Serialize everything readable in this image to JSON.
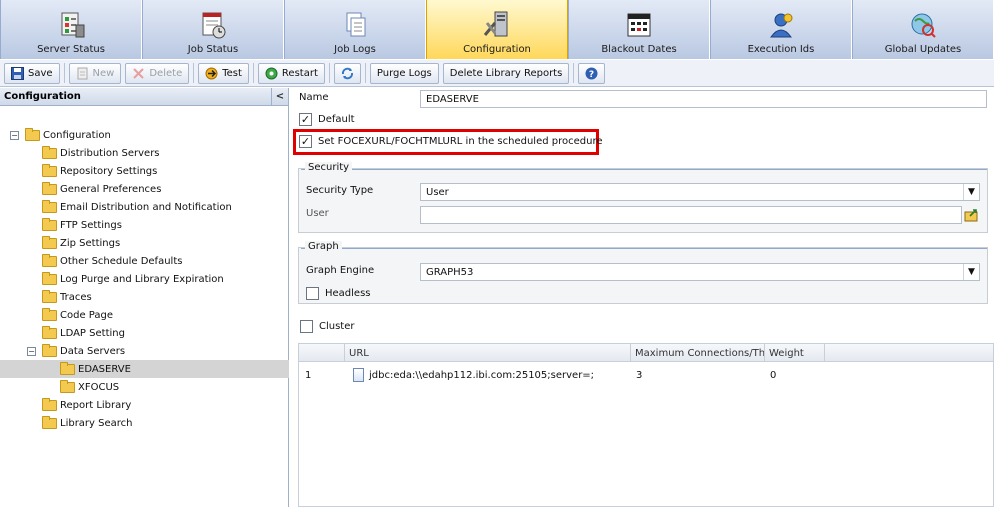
{
  "tabs": [
    {
      "label": "Server Status",
      "icon": "server-status-icon"
    },
    {
      "label": "Job Status",
      "icon": "job-status-icon"
    },
    {
      "label": "Job Logs",
      "icon": "job-logs-icon"
    },
    {
      "label": "Configuration",
      "icon": "configuration-icon",
      "active": true
    },
    {
      "label": "Blackout Dates",
      "icon": "calendar-icon"
    },
    {
      "label": "Execution Ids",
      "icon": "execution-ids-icon"
    },
    {
      "label": "Global Updates",
      "icon": "global-updates-icon"
    }
  ],
  "toolbar": {
    "save": "Save",
    "new": "New",
    "delete": "Delete",
    "test": "Test",
    "restart": "Restart",
    "purge_logs": "Purge Logs",
    "delete_library_reports": "Delete Library Reports"
  },
  "left": {
    "title": "Configuration",
    "collapse": "<",
    "tree": {
      "root": "Configuration",
      "items": [
        "Distribution Servers",
        "Repository Settings",
        "General Preferences",
        "Email Distribution and Notification",
        "FTP Settings",
        "Zip Settings",
        "Other Schedule Defaults",
        "Log Purge and Library Expiration",
        "Traces",
        "Code Page",
        "LDAP Setting",
        "Data Servers"
      ],
      "data_servers": [
        "EDASERVE",
        "XFOCUS"
      ],
      "after": [
        "Report Library",
        "Library Search"
      ]
    }
  },
  "form": {
    "name_label": "Name",
    "name_value": "EDASERVE",
    "default_label": "Default",
    "default_checked": true,
    "focexurl_label": "Set FOCEXURL/FOCHTMLURL in the scheduled procedure",
    "focexurl_checked": true,
    "security": {
      "legend": "Security",
      "type_label": "Security Type",
      "type_value": "User",
      "user_label": "User",
      "user_value": ""
    },
    "graph": {
      "legend": "Graph",
      "engine_label": "Graph Engine",
      "engine_value": "GRAPH53",
      "headless_label": "Headless",
      "headless_checked": false
    },
    "cluster_label": "Cluster",
    "cluster_checked": false
  },
  "grid": {
    "columns": [
      "URL",
      "Maximum Connections/Threads",
      "Weight"
    ],
    "rows": [
      {
        "num": "1",
        "url": "jdbc:eda:\\\\edahp112.ibi.com:25105;server=;",
        "max": "3",
        "weight": "0"
      }
    ]
  },
  "colors": {
    "accent_active_tab": "#ffd85a",
    "highlight_border": "#e00000",
    "selection": "#d4d4d4"
  }
}
